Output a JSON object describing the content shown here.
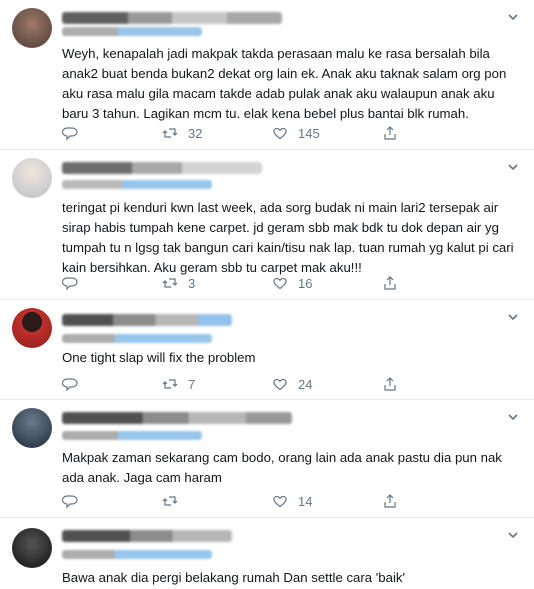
{
  "tweets": [
    {
      "text": "Weyh, kenapalah jadi makpak takda perasaan malu ke rasa bersalah bila anak2 buat benda bukan2 dekat org lain ek. Anak aku taknak salam org pon aku rasa malu gila macam takde adab pulak anak aku walaupun anak aku baru 3 tahun. Lagikan mcm tu. elak kena bebel plus bantai blk rumah.",
      "retweets": "32",
      "likes": "145",
      "avatar_color": "#7a5c50"
    },
    {
      "text": "teringat pi kenduri kwn last week, ada sorg budak ni main lari2 tersepak air sirap habis tumpah kene carpet. jd geram sbb mak bdk tu dok depan air yg tumpah tu n lgsg tak bangun cari kain/tisu nak lap. tuan rumah yg kalut pi cari kain bersihkan. Aku geram sbb tu carpet mak aku!!!",
      "retweets": "3",
      "likes": "16",
      "avatar_color": "#c8cdd3"
    },
    {
      "text": "One tight slap will fix the problem",
      "retweets": "7",
      "likes": "24",
      "avatar_color": "#b5322f"
    },
    {
      "text": "Makpak zaman sekarang cam bodo, orang lain ada anak pastu dia pun nak ada anak. Jaga cam haram",
      "retweets": "",
      "likes": "14",
      "avatar_color": "#3a4a5c"
    },
    {
      "text": "Bawa anak dia pergi belakang rumah Dan settle cara 'baik'",
      "retweets": "",
      "likes": "",
      "avatar_color": "#2b2b2b"
    }
  ],
  "colors": {
    "muted": "#657786",
    "border": "#e6ecf0",
    "link_blur": "#1da1f2"
  }
}
